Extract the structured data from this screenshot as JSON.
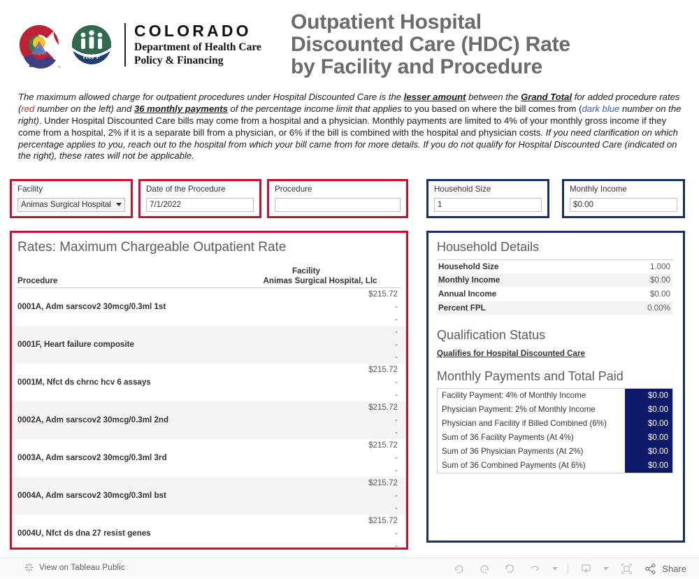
{
  "header": {
    "logo": {
      "colorado": "COLORADO",
      "dept_line1": "Department of Health Care",
      "dept_line2": "Policy & Financing",
      "hcpf_mark": "HCPF"
    },
    "title_line1": "Outpatient Hospital",
    "title_line2": "Discounted Care (HDC) Rate",
    "title_line3": "by Facility and Procedure"
  },
  "description": {
    "p1": "The maximum allowed charge for outpatient procedures under Hospital Discounted Care is the ",
    "b1": "lesser amount",
    "p2": " between the ",
    "b2": "Grand Total",
    "p3": " for added procedure rates (",
    "red_word": "red",
    "p4": " number on the left) and ",
    "b3": "36 monthly payments",
    "p5": " of the percentage income limit that applies ",
    "p6": "to you based on where the bill comes from (",
    "blue_word": "dark blue",
    "p7": " number on the right)",
    "p8": ". Under Hospital Discounted Care bills may come from a hospital and a physician. Monthly payments are limited to 4% of your monthly gross income if they come from a hospital, 2% if it is a separate bill from a physician, or 6% if the bill is combined with the hospital and physician costs",
    "p9": ". If you need clarification on which percentage applies to you, reach out to the hospital from which your bill came from for more details. If you do not qualify for Hospital Discounted Care (indicated on the right), these rates will not be applicable."
  },
  "filters": [
    {
      "name": "facility",
      "label": "Facility",
      "value": "Animas Surgical Hospital, ...",
      "type": "dropdown",
      "accent": "#c8102e"
    },
    {
      "name": "date",
      "label": "Date of the Procedure",
      "value": "7/1/2022",
      "type": "text",
      "accent": "#c8102e"
    },
    {
      "name": "procedure",
      "label": "Procedure",
      "value": "",
      "type": "text",
      "accent": "#c8102e"
    },
    {
      "name": "household",
      "label": "Household Size",
      "value": "1",
      "type": "text",
      "accent": "#17306b"
    },
    {
      "name": "income",
      "label": "Monthly Income",
      "value": "$0.00",
      "type": "text",
      "accent": "#17306b"
    }
  ],
  "rates": {
    "title": "Rates: Maximum Chargeable Outpatient Rate",
    "group_header": "Facility",
    "col_procedure": "Procedure",
    "col_facility": "Animas Surgical Hospital, Llc",
    "rows": [
      {
        "procedure": "0001A, Adm sarscov2 30mcg/0.3ml 1st",
        "values": [
          "$215.72",
          "-",
          "-"
        ]
      },
      {
        "procedure": "0001F, Heart failure composite",
        "values": [
          "-",
          "-",
          "-"
        ]
      },
      {
        "procedure": "0001M, Nfct ds chrnc hcv 6 assays",
        "values": [
          "$215.72",
          "-",
          "-"
        ]
      },
      {
        "procedure": "0002A, Adm sarscov2 30mcg/0.3ml 2nd",
        "values": [
          "$215.72",
          "-",
          "-"
        ]
      },
      {
        "procedure": "0003A, Adm sarscov2 30mcg/0.3ml 3rd",
        "values": [
          "$215.72",
          "-",
          "-"
        ]
      },
      {
        "procedure": "0004A, Adm sarscov2 30mcg/0.3ml bst",
        "values": [
          "$215.72",
          "-",
          "-"
        ]
      },
      {
        "procedure": "0004U, Nfct ds dna 27 resist genes",
        "values": [
          "$215.72",
          "-",
          "-"
        ]
      }
    ]
  },
  "household_details": {
    "title": "Household Details",
    "rows": [
      {
        "label": "Household Size",
        "value": "1.000"
      },
      {
        "label": "Monthly Income",
        "value": "$0.00"
      },
      {
        "label": "Annual Income",
        "value": "$0.00"
      },
      {
        "label": "Percent FPL",
        "value": "0.00%"
      }
    ]
  },
  "qualification": {
    "title": "Qualification Status",
    "status": "Qualifies for Hospital Discounted Care"
  },
  "payments": {
    "title": "Monthly Payments and Total Paid",
    "value_bg": "#101a6b",
    "rows": [
      {
        "label": "Facility Payment: 4% of Monthly Income",
        "value": "$0.00"
      },
      {
        "label": "Physician Payment: 2% of Monthly Income",
        "value": "$0.00"
      },
      {
        "label": "Physician and Facility if Billed Combined (6%)",
        "value": "$0.00"
      },
      {
        "label": "Sum of 36 Facility Payments (At 4%)",
        "value": "$0.00"
      },
      {
        "label": "Sum of 36 Physician Payments (At 2%)",
        "value": "$0.00"
      },
      {
        "label": "Sum of 36 Combined Payments (At 6%)",
        "value": "$0.00"
      }
    ]
  },
  "bottombar": {
    "tableau_label": "View on Tableau Public",
    "share_label": "Share",
    "icons": [
      "undo-icon",
      "redo-icon",
      "revert-icon",
      "refresh-icon",
      "caret-down-icon",
      "download-icon",
      "fullscreen-icon",
      "share-icon"
    ]
  }
}
